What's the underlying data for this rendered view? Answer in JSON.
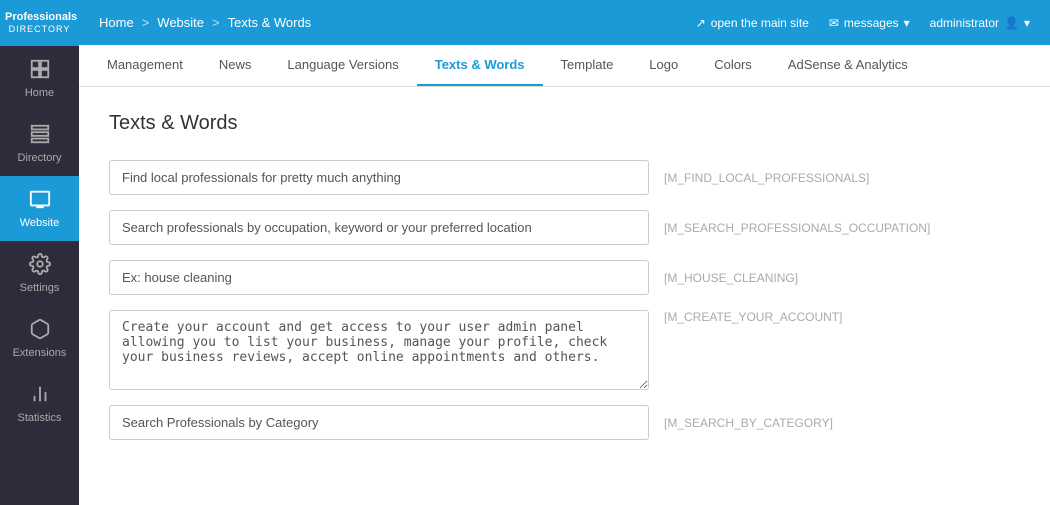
{
  "brand": {
    "name": "Professionals",
    "sub": "DIRECTORY"
  },
  "sidebar": {
    "items": [
      {
        "label": "Home",
        "icon": "⊞",
        "active": false
      },
      {
        "label": "Directory",
        "icon": "☰",
        "active": false
      },
      {
        "label": "Website",
        "icon": "🖥",
        "active": true
      },
      {
        "label": "Settings",
        "icon": "⚙",
        "active": false
      },
      {
        "label": "Extensions",
        "icon": "📦",
        "active": false
      },
      {
        "label": "Statistics",
        "icon": "📈",
        "active": false
      }
    ]
  },
  "topbar": {
    "home": "Home",
    "sep1": ">",
    "website": "Website",
    "sep2": ">",
    "current": "Texts & Words",
    "open_site": "open the main site",
    "messages": "messages",
    "admin": "administrator"
  },
  "tabs": [
    {
      "label": "Management",
      "active": false
    },
    {
      "label": "News",
      "active": false
    },
    {
      "label": "Language Versions",
      "active": false
    },
    {
      "label": "Texts & Words",
      "active": true
    },
    {
      "label": "Template",
      "active": false
    },
    {
      "label": "Logo",
      "active": false
    },
    {
      "label": "Colors",
      "active": false
    },
    {
      "label": "AdSense & Analytics",
      "active": false
    }
  ],
  "page": {
    "title": "Texts & Words",
    "fields": [
      {
        "id": "field1",
        "value": "Find local professionals for pretty much anything",
        "tag": "[M_FIND_LOCAL_PROFESSIONALS]",
        "type": "text"
      },
      {
        "id": "field2",
        "value": "Search professionals by occupation, keyword or your preferred location",
        "tag": "[M_SEARCH_PROFESSIONALS_OCCUPATION]",
        "type": "text"
      },
      {
        "id": "field3",
        "value": "Ex: house cleaning",
        "tag": "[M_HOUSE_CLEANING]",
        "type": "text"
      },
      {
        "id": "field4",
        "value": "Create your account and get access to your user admin panel allowing you to list your business, manage your profile, check your business reviews, accept online appointments and others.",
        "tag": "[M_CREATE_YOUR_ACCOUNT]",
        "type": "textarea"
      },
      {
        "id": "field5",
        "value": "Search Professionals by Category",
        "tag": "[M_SEARCH_BY_CATEGORY]",
        "type": "text"
      }
    ]
  }
}
